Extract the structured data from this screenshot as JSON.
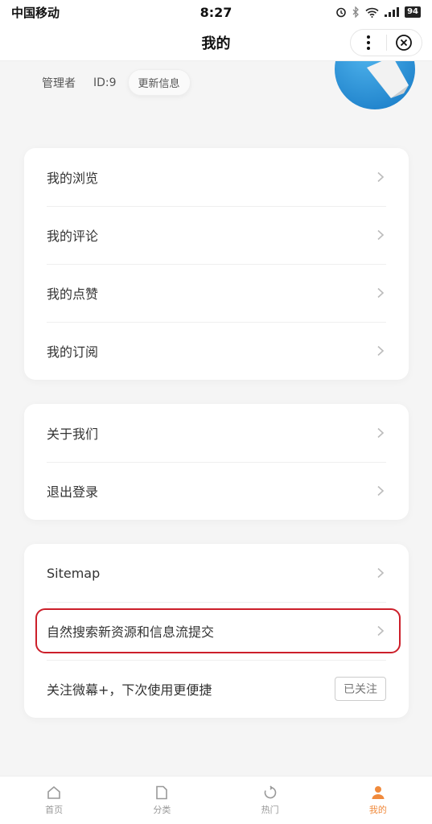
{
  "status_bar": {
    "carrier": "中国移动",
    "time": "8:27",
    "battery": "94"
  },
  "nav": {
    "title": "我的"
  },
  "profile": {
    "role": "管理者",
    "uid": "ID:9",
    "update_label": "更新信息"
  },
  "menu_group_1": [
    {
      "label": "我的浏览"
    },
    {
      "label": "我的评论"
    },
    {
      "label": "我的点赞"
    },
    {
      "label": "我的订阅"
    }
  ],
  "menu_group_2": [
    {
      "label": "关于我们"
    },
    {
      "label": "退出登录"
    }
  ],
  "menu_group_3": {
    "sitemap": "Sitemap",
    "submit": "自然搜索新资源和信息流提交",
    "follow_text": "关注微幕+，下次使用更便捷",
    "follow_button": "已关注"
  },
  "tab_bar": [
    {
      "label": "首页",
      "icon": "home-icon"
    },
    {
      "label": "分类",
      "icon": "category-icon"
    },
    {
      "label": "热门",
      "icon": "hot-icon"
    },
    {
      "label": "我的",
      "icon": "user-icon",
      "active": true
    }
  ],
  "colors": {
    "accent": "#f08a3c",
    "highlight": "#cc1f2a"
  }
}
